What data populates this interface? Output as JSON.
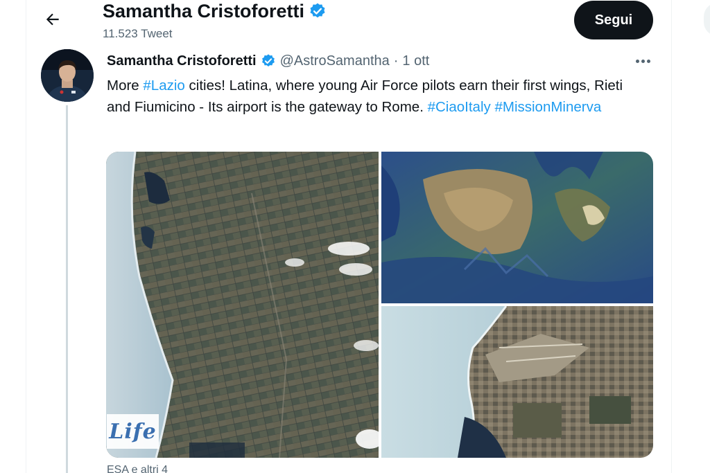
{
  "header": {
    "name": "Samantha Cristoforetti",
    "tweet_count": "11.523 Tweet",
    "follow_label": "Segui"
  },
  "tweet": {
    "author_name": "Samantha Cristoforetti",
    "handle": "@AstroSamantha",
    "separator": "·",
    "date": "1 ott",
    "text": {
      "t1": "More ",
      "h1": "#Lazio",
      "t2": " cities! Latina, where young Air Force pilots earn their first wings, Rieti and Fiumicino - Its airport is the gateway to Rome. ",
      "h2": "#CiaoItaly",
      "t3": " ",
      "h3": "#MissionMinerva"
    },
    "tagged": "ESA e altri 4"
  },
  "watermark": "Life",
  "colors": {
    "accent": "#1d9bf0",
    "text": "#0f1419",
    "secondary": "#536471",
    "follow_bg": "#0f1419"
  },
  "icons": {
    "back": "arrow-left-icon",
    "verified": "verified-badge-icon",
    "more": "more-horizontal-icon"
  }
}
